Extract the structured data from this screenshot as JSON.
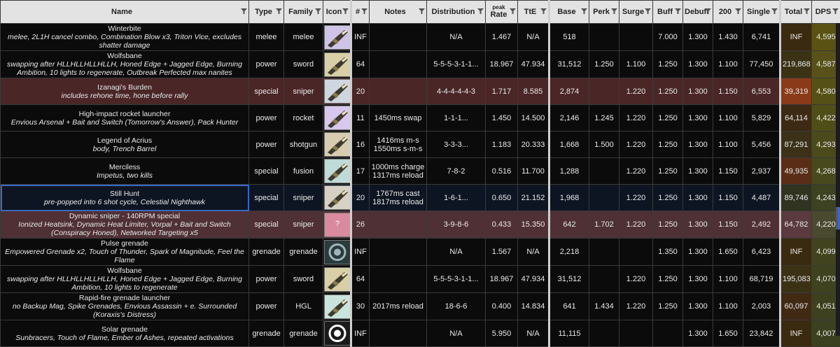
{
  "header": {
    "name": "Name",
    "type": "Type",
    "family": "Family",
    "icon": "Icon",
    "num": "#",
    "notes": "Notes",
    "distribution": "Distribution",
    "peak": "peak",
    "rate": "Rate",
    "tte": "TtE",
    "base": "Base",
    "perk": "Perk",
    "surge": "Surge",
    "buff": "Buff",
    "debuff": "Debufl",
    "c200": "200",
    "single": "Single",
    "total": "Total",
    "dps": "DPS"
  },
  "colors": {
    "selected_outline": "#3a68c2",
    "header_bg": "#e3e3e3"
  },
  "rows": [
    {
      "title": "Winterbite",
      "desc": "melee, 2L1H cancel combo, Combination Blow x3, Triton Vice, excludes shatter damage",
      "type": "melee",
      "family": "melee",
      "icon": "weapon-icon-winterbite",
      "num": "INF",
      "notes": "",
      "distribution": "N/A",
      "rate": "1.467",
      "tte": "N/A",
      "base": "518",
      "perk": "",
      "surge": "",
      "buff": "7.000",
      "debuff": "1.300",
      "c200": "1.430",
      "single": "6,741",
      "total": "INF",
      "dps": "4,595",
      "total_bg": "#3a2a0f",
      "dps_bg": "#5a5212"
    },
    {
      "title": "Wolfsbane",
      "desc": "swapping after HLLHLLHLLHLLH, Honed Edge + Jagged Edge, Burning Ambition, 10 lights to regenerate, Outbreak Perfected max nanites",
      "type": "power",
      "family": "sword",
      "icon": "weapon-icon-wolfsbane",
      "num": "64",
      "notes": "",
      "distribution": "5-5-5-3-1-1...",
      "rate": "18.967",
      "tte": "47.934",
      "base": "31,512",
      "perk": "1.250",
      "surge": "1.100",
      "buff": "1.250",
      "debuff": "1.300",
      "c200": "1.100",
      "single": "77,450",
      "total": "219,868",
      "dps": "4,587",
      "total_bg": "#3b3216",
      "dps_bg": "#58521a"
    },
    {
      "title": "Izanagi's Burden",
      "desc": "includes rehone time, hone before rally",
      "type": "special",
      "family": "sniper",
      "icon": "weapon-icon-izanagi",
      "num": "20",
      "notes": "",
      "distribution": "4-4-4-4-4-3",
      "rate": "1.717",
      "tte": "8.585",
      "base": "2,874",
      "perk": "",
      "surge": "1.220",
      "buff": "1.250",
      "debuff": "1.300",
      "c200": "1.150",
      "single": "6,553",
      "total": "39,319",
      "dps": "4,580",
      "total_bg": "#8a3a18",
      "dps_bg": "#555116",
      "row_class": "hl"
    },
    {
      "title": "High-impact rocket launcher",
      "desc": "Envious Arsenal + Bait and Switch (Tomorrow's Answer), Pack Hunter",
      "type": "power",
      "family": "rocket",
      "icon": "weapon-icon-rocket",
      "num": "11",
      "notes": "1450ms swap",
      "distribution": "1-1-1...",
      "rate": "1.450",
      "tte": "14.500",
      "base": "2,146",
      "perk": "1.245",
      "surge": "1.220",
      "buff": "1.250",
      "debuff": "1.300",
      "c200": "1.100",
      "single": "5,829",
      "total": "64,114",
      "dps": "4,422",
      "total_bg": "#3d2a14",
      "dps_bg": "#4f4d18"
    },
    {
      "title": "Legend of Acrius",
      "desc": "body, Trench Barrel",
      "type": "power",
      "family": "shotgun",
      "icon": "weapon-icon-acrius",
      "num": "16",
      "notes": "1416ms m-s\n1550ms s-m-s",
      "distribution": "3-3-3...",
      "rate": "1.183",
      "tte": "20.333",
      "base": "1,668",
      "perk": "1.500",
      "surge": "1.220",
      "buff": "1.250",
      "debuff": "1.300",
      "c200": "1.100",
      "single": "5,456",
      "total": "87,291",
      "dps": "4,293",
      "total_bg": "#3a3118",
      "dps_bg": "#4a4a1c"
    },
    {
      "title": "Merciless",
      "desc": "Impetus, two kills",
      "type": "special",
      "family": "fusion",
      "icon": "weapon-icon-merciless",
      "num": "17",
      "notes": "1000ms charge\n1317ms reload",
      "distribution": "7-8-2",
      "rate": "0.516",
      "tte": "11.700",
      "base": "1,288",
      "perk": "",
      "surge": "1.220",
      "buff": "1.250",
      "debuff": "1.300",
      "c200": "1.150",
      "single": "2,937",
      "total": "49,935",
      "dps": "4,268",
      "total_bg": "#5a2e16",
      "dps_bg": "#48491d"
    },
    {
      "title": "Still Hunt",
      "desc": "pre-popped into 6 shot cycle, Celestial Nighthawk",
      "type": "special",
      "family": "sniper",
      "icon": "weapon-icon-still-hunt",
      "num": "20",
      "notes": "1767ms cast\n1817ms reload",
      "distribution": "1-6-1...",
      "rate": "0.650",
      "tte": "21.152",
      "base": "1,968",
      "perk": "",
      "surge": "1.220",
      "buff": "1.250",
      "debuff": "1.300",
      "c200": "1.150",
      "single": "4,487",
      "total": "89,746",
      "dps": "4,243",
      "total_bg": "#2f3320",
      "dps_bg": "#3c4222",
      "row_class": "sel"
    },
    {
      "title": "Dynamic sniper - 140RPM special",
      "desc": "Ionized Heatsink, Dynamic Heat Limiter, Vorpal + Bait and Switch (Conspiracy Honed), Networked Targeting x5",
      "type": "special",
      "family": "sniper",
      "icon": "unknown-weapon-icon",
      "icon_text": "?",
      "num": "26",
      "notes": "",
      "distribution": "3-9-8-6",
      "rate": "0.433",
      "tte": "15.350",
      "base": "642",
      "perk": "1.702",
      "surge": "1.220",
      "buff": "1.250",
      "debuff": "1.300",
      "c200": "1.150",
      "single": "2,492",
      "total": "64,782",
      "dps": "4,220",
      "total_bg": "#5a3a3e",
      "dps_bg": "#4a4a30",
      "row_class": "hl2"
    },
    {
      "title": "Pulse grenade",
      "desc": "Empowered Grenade x2, Touch of Thunder, Spark of Magnitude, Feel the Flame",
      "type": "grenade",
      "family": "grenade",
      "icon": "grenade-icon-pulse",
      "num": "INF",
      "notes": "",
      "distribution": "N/A",
      "rate": "1.567",
      "tte": "N/A",
      "base": "2,218",
      "perk": "",
      "surge": "",
      "buff": "1.350",
      "debuff": "1.300",
      "c200": "1.650",
      "single": "6,423",
      "total": "INF",
      "dps": "4,099",
      "total_bg": "#3a2a0f",
      "dps_bg": "#41431f"
    },
    {
      "title": "Wolfsbane",
      "desc": "swapping after HLLHLLHLLHLLH, Honed Edge + Jagged Edge, Burning Ambition, 10 lights to regenerate",
      "type": "power",
      "family": "sword",
      "icon": "weapon-icon-wolfsbane",
      "num": "64",
      "notes": "",
      "distribution": "5-5-5-3-1-1...",
      "rate": "18.967",
      "tte": "47.934",
      "base": "31,512",
      "perk": "",
      "surge": "1.220",
      "buff": "1.250",
      "debuff": "1.300",
      "c200": "1.100",
      "single": "68,719",
      "total": "195,083",
      "dps": "4,070",
      "total_bg": "#3b3216",
      "dps_bg": "#3f421f"
    },
    {
      "title": "Rapid-fire grenade launcher",
      "desc": "no Backup Mag, Spike Grenades, Envious Assassin + e. Surrounded (Koraxis's Distress)",
      "type": "power",
      "family": "HGL",
      "icon": "weapon-icon-hgl",
      "num": "30",
      "notes": "2017ms reload",
      "distribution": "18-6-6",
      "rate": "0.400",
      "tte": "14.834",
      "base": "641",
      "perk": "1.434",
      "surge": "1.220",
      "buff": "1.250",
      "debuff": "1.300",
      "c200": "1.100",
      "single": "2,003",
      "total": "60,097",
      "dps": "4,051",
      "total_bg": "#402a14",
      "dps_bg": "#3d4120"
    },
    {
      "title": "Solar grenade",
      "desc": "Sunbracers, Touch of Flame, Ember of Ashes, repeated activations",
      "type": "grenade",
      "family": "grenade",
      "icon": "grenade-icon-solar",
      "num": "INF",
      "notes": "",
      "distribution": "N/A",
      "rate": "5.950",
      "tte": "N/A",
      "base": "11,115",
      "perk": "",
      "surge": "",
      "buff": "",
      "debuff": "1.300",
      "c200": "1.650",
      "single": "23,842",
      "total": "INF",
      "dps": "4,007",
      "total_bg": "#3a2a0f",
      "dps_bg": "#3b4020"
    }
  ]
}
